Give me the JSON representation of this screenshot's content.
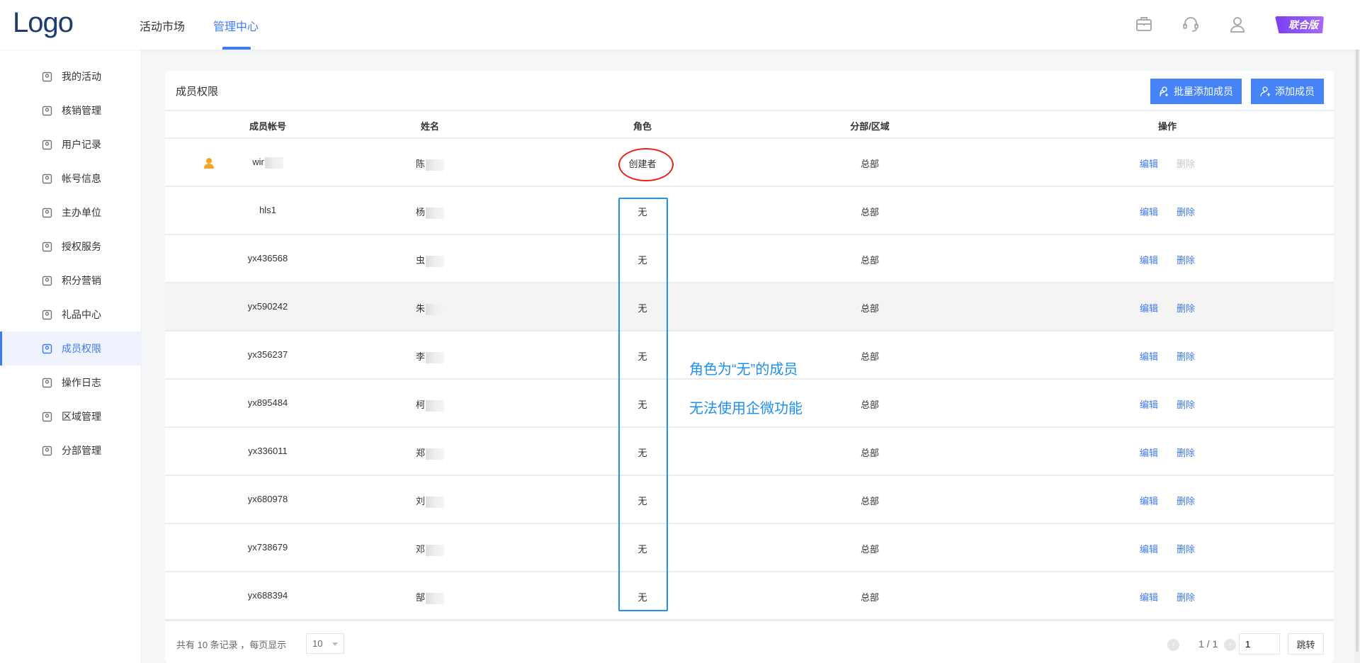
{
  "header": {
    "logo": "Logo",
    "nav": [
      {
        "label": "活动市场"
      },
      {
        "label": "管理中心",
        "active": true
      }
    ],
    "icons": [
      "briefcase-icon",
      "headset-icon",
      "user-icon"
    ],
    "badge": "联合版"
  },
  "sidebar": {
    "items": [
      {
        "label": "我的活动",
        "icon": "user-icon"
      },
      {
        "label": "核销管理",
        "icon": "clipboard-check-icon"
      },
      {
        "label": "用户记录",
        "icon": "id-card-icon"
      },
      {
        "label": "帐号信息",
        "icon": "id-card-icon"
      },
      {
        "label": "主办单位",
        "icon": "building-icon"
      },
      {
        "label": "授权服务",
        "icon": "stamp-icon"
      },
      {
        "label": "积分营销",
        "icon": "star-circle-icon"
      },
      {
        "label": "礼品中心",
        "icon": "gift-icon"
      },
      {
        "label": "成员权限",
        "icon": "user-edit-icon",
        "active": true
      },
      {
        "label": "操作日志",
        "icon": "log-icon"
      },
      {
        "label": "区域管理",
        "icon": "location-icon"
      },
      {
        "label": "分部管理",
        "icon": "org-chart-icon"
      }
    ]
  },
  "card": {
    "title": "成员权限",
    "batch_add": "批量添加成员",
    "add": "添加成员"
  },
  "table": {
    "columns": [
      "成员帐号",
      "姓名",
      "角色",
      "分部/区域",
      "操作"
    ],
    "rows": [
      {
        "account": "wir",
        "name": "陈",
        "role": "创建者",
        "branch": "总部",
        "edit": "编辑",
        "delete": "删除",
        "creator": true
      },
      {
        "account": "hls1",
        "name": "杨",
        "role": "无",
        "branch": "总部",
        "edit": "编辑",
        "delete": "删除"
      },
      {
        "account": "yx436568",
        "name": "虫",
        "role": "无",
        "branch": "总部",
        "edit": "编辑",
        "delete": "删除"
      },
      {
        "account": "yx590242",
        "name": "朱",
        "role": "无",
        "branch": "总部",
        "edit": "编辑",
        "delete": "删除"
      },
      {
        "account": "yx356237",
        "name": "李",
        "role": "无",
        "branch": "总部",
        "edit": "编辑",
        "delete": "删除"
      },
      {
        "account": "yx895484",
        "name": "柯",
        "role": "无",
        "branch": "总部",
        "edit": "编辑",
        "delete": "删除"
      },
      {
        "account": "yx336011",
        "name": "郑",
        "role": "无",
        "branch": "总部",
        "edit": "编辑",
        "delete": "删除"
      },
      {
        "account": "yx680978",
        "name": "刘",
        "role": "无",
        "branch": "总部",
        "edit": "编辑",
        "delete": "删除"
      },
      {
        "account": "yx738679",
        "name": "邓",
        "role": "无",
        "branch": "总部",
        "edit": "编辑",
        "delete": "删除"
      },
      {
        "account": "yx688394",
        "name": "郜",
        "role": "无",
        "branch": "总部",
        "edit": "编辑",
        "delete": "删除"
      }
    ]
  },
  "annotation": {
    "line1": "角色为“无”的成员",
    "line2": "无法使用企微功能"
  },
  "footer": {
    "summary": "共有 10 条记录 ，每页显示",
    "page_size": "10",
    "page": "1 / 1",
    "jump_value": "1",
    "jump": "跳转"
  },
  "colors": {
    "accent": "#3d7bf6",
    "annotation_red": "#e8221b",
    "annotation_blue": "#1e90f0",
    "badge": "#8a4ff3"
  }
}
